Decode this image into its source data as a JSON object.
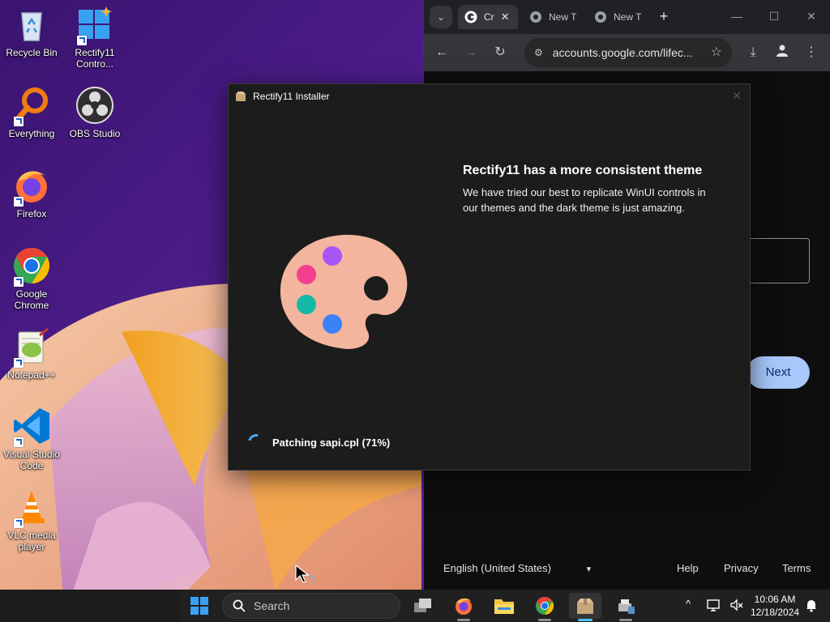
{
  "desktop": {
    "icons": [
      {
        "label": "Recycle Bin",
        "shortcut": false,
        "icon": "recycle-bin-icon"
      },
      {
        "label": "Rectify11 Contro...",
        "shortcut": true,
        "icon": "rectify11-control-icon"
      },
      {
        "label": "Everything",
        "shortcut": true,
        "icon": "everything-search-icon"
      },
      {
        "label": "OBS Studio",
        "shortcut": false,
        "icon": "obs-studio-icon"
      },
      {
        "label": "Firefox",
        "shortcut": true,
        "icon": "firefox-icon"
      },
      {
        "label": "Google Chrome",
        "shortcut": true,
        "icon": "chrome-icon"
      },
      {
        "label": "Notepad++",
        "shortcut": true,
        "icon": "notepadplusplus-icon"
      },
      {
        "label": "Visual Studio Code",
        "shortcut": true,
        "icon": "vscode-icon"
      },
      {
        "label": "VLC media player",
        "shortcut": true,
        "icon": "vlc-icon"
      }
    ]
  },
  "chrome": {
    "tabs": [
      {
        "title": "Cr",
        "close": "✕",
        "favicon": "google-g-icon",
        "active": true
      },
      {
        "title": "New T",
        "favicon": "chrome-favicon",
        "active": false
      },
      {
        "title": "New T",
        "favicon": "chrome-favicon",
        "active": false
      }
    ],
    "new_tab": "+",
    "window_controls": {
      "minimize": "—",
      "maximize": "☐",
      "close": "✕"
    },
    "toolbar": {
      "back": "←",
      "forward": "→",
      "reload": "↻",
      "url": "accounts.google.com/lifec...",
      "bookmark": "☆",
      "download": "⤓",
      "menu": "⋮"
    },
    "page": {
      "next_button": "Next",
      "footer": {
        "language": "English (United States)",
        "dropdown": "▾",
        "links": [
          "Help",
          "Privacy",
          "Terms"
        ]
      }
    }
  },
  "installer": {
    "window_title": "Rectify11 Installer",
    "close": "✕",
    "heading": "Rectify11 has a more consistent theme",
    "description": "We have tried our best to replicate WinUI controls in our themes and the dark theme is just amazing.",
    "status": "Patching sapi.cpl (71%)",
    "progress_percent": 71,
    "palette_colors": [
      "#f3b59e",
      "#a855f7",
      "#f43f8e",
      "#14b8a6",
      "#3b82f6"
    ]
  },
  "taskbar": {
    "search_label": "Search",
    "apps": [
      "task-view-icon",
      "firefox-icon",
      "file-explorer-icon",
      "chrome-icon",
      "rectify11-installer-icon",
      "printer-network-icon"
    ],
    "active_app": "rectify11-installer-icon",
    "tray": {
      "chevron": "^",
      "time": "10:06 AM",
      "date": "12/18/2024"
    }
  },
  "colors": {
    "accent": "#4cc2ff",
    "chrome_next": "#a8c7fa",
    "spinner": "#4aa8f0"
  }
}
